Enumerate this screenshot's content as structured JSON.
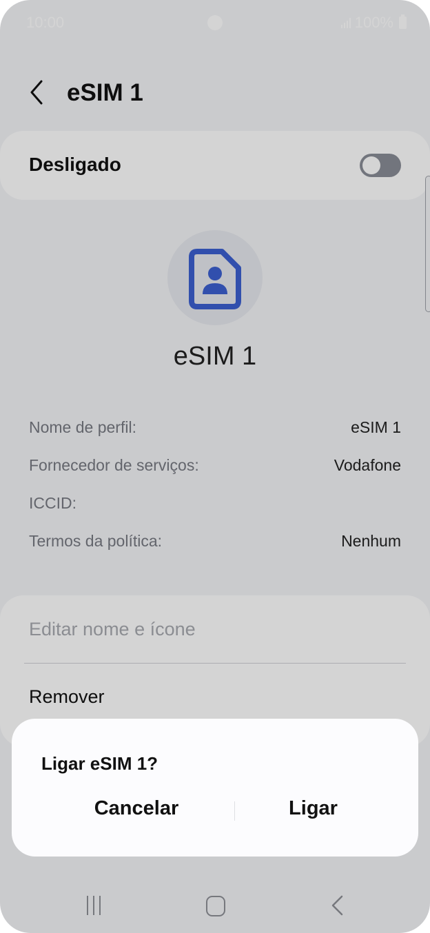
{
  "status_bar": {
    "time": "10:00",
    "battery": "100%"
  },
  "header": {
    "title": "eSIM 1",
    "back_icon": "chevron-left-icon"
  },
  "toggle": {
    "label": "Desligado",
    "state": "off"
  },
  "profile": {
    "icon": "sim-card-person-icon",
    "name": "eSIM 1"
  },
  "info": [
    {
      "label": "Nome de perfil:",
      "value": "eSIM 1"
    },
    {
      "label": "Fornecedor de serviços:",
      "value": "Vodafone"
    },
    {
      "label": "ICCID:",
      "value": ""
    },
    {
      "label": "Termos da política:",
      "value": "Nenhum"
    }
  ],
  "actions": {
    "edit": "Editar nome e ícone",
    "remove": "Remover"
  },
  "dialog": {
    "title": "Ligar eSIM 1?",
    "cancel": "Cancelar",
    "confirm": "Ligar"
  },
  "nav": {
    "recents_icon": "recents-icon",
    "home_icon": "home-icon",
    "back_icon": "back-icon"
  },
  "colors": {
    "accent": "#3b5fd0",
    "dim_overlay": "rgba(0,0,0,0.17)",
    "dialog_bg": "#fcfcfe"
  }
}
